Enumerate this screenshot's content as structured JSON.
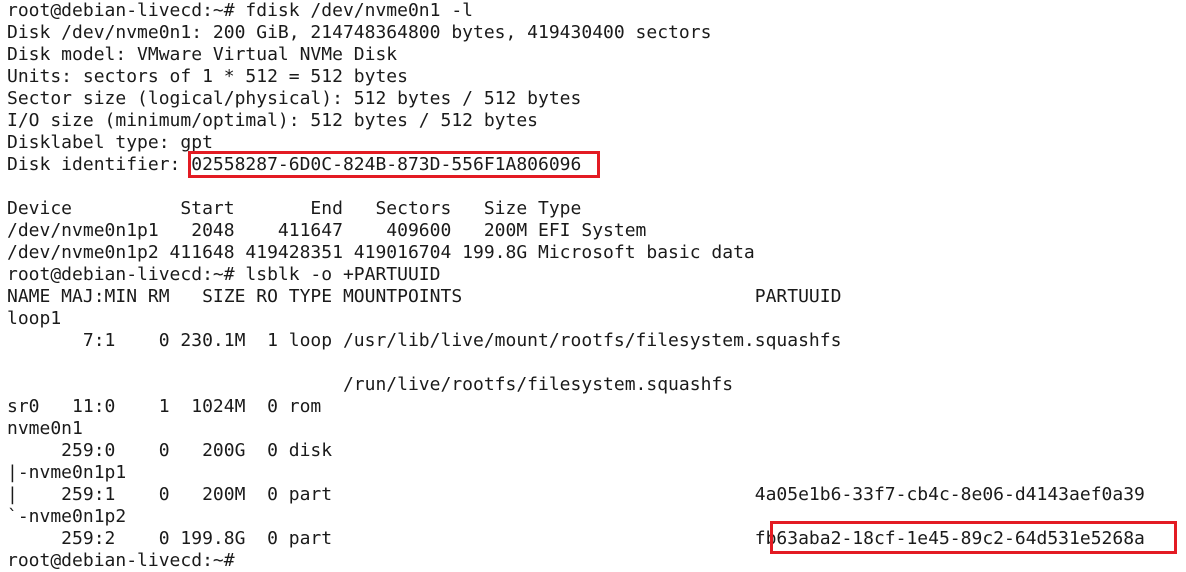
{
  "terminal": {
    "lines": [
      "root@debian-livecd:~# fdisk /dev/nvme0n1 -l",
      "Disk /dev/nvme0n1: 200 GiB, 214748364800 bytes, 419430400 sectors",
      "Disk model: VMware Virtual NVMe Disk",
      "Units: sectors of 1 * 512 = 512 bytes",
      "Sector size (logical/physical): 512 bytes / 512 bytes",
      "I/O size (minimum/optimal): 512 bytes / 512 bytes",
      "Disklabel type: gpt",
      "Disk identifier: 02558287-6D0C-824B-873D-556F1A806096",
      "",
      "Device          Start       End   Sectors   Size Type",
      "/dev/nvme0n1p1   2048    411647    409600   200M EFI System",
      "/dev/nvme0n1p2 411648 419428351 419016704 199.8G Microsoft basic data",
      "root@debian-livecd:~# lsblk -o +PARTUUID",
      "NAME MAJ:MIN RM   SIZE RO TYPE MOUNTPOINTS                           PARTUUID",
      "loop1",
      "       7:1    0 230.1M  1 loop /usr/lib/live/mount/rootfs/filesystem.squashfs",
      "",
      "                               /run/live/rootfs/filesystem.squashfs",
      "sr0   11:0    1  1024M  0 rom",
      "nvme0n1",
      "     259:0    0   200G  0 disk",
      "|-nvme0n1p1",
      "|    259:1    0   200M  0 part                                       4a05e1b6-33f7-cb4c-8e06-d4143aef0a39",
      "`-nvme0n1p2",
      "     259:2    0 199.8G  0 part                                       fb63aba2-18cf-1e45-89c2-64d531e5268a",
      "root@debian-livecd:~#"
    ]
  },
  "colors": {
    "background": "#ffffff",
    "text": "#1a1a1a",
    "highlight": "#e31b23"
  }
}
